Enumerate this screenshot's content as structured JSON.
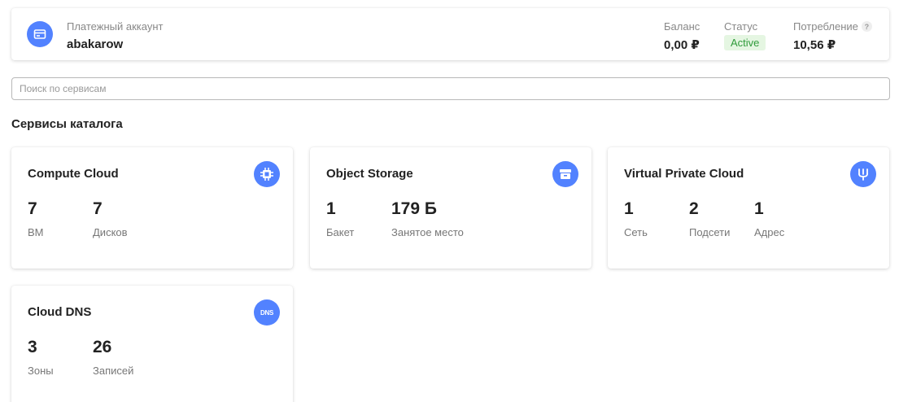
{
  "billing": {
    "label": "Платежный аккаунт",
    "name": "abakarow",
    "balance": {
      "label": "Баланс",
      "value": "0,00 ₽"
    },
    "status": {
      "label": "Статус",
      "value": "Active"
    },
    "consumption": {
      "label": "Потребление",
      "value": "10,56 ₽",
      "help": "?"
    }
  },
  "search": {
    "placeholder": "Поиск по сервисам",
    "value": ""
  },
  "section_title": "Сервисы каталога",
  "services": [
    {
      "title": "Compute Cloud",
      "icon": "chip-icon",
      "metrics": [
        {
          "value": "7",
          "label": "ВМ"
        },
        {
          "value": "7",
          "label": "Дисков"
        }
      ]
    },
    {
      "title": "Object Storage",
      "icon": "storage-box-icon",
      "metrics": [
        {
          "value": "1",
          "label": "Бакет"
        },
        {
          "value": "179 Б",
          "label": "Занятое место"
        }
      ]
    },
    {
      "title": "Virtual Private Cloud",
      "icon": "network-icon",
      "metrics": [
        {
          "value": "1",
          "label": "Сеть"
        },
        {
          "value": "2",
          "label": "Подсети"
        },
        {
          "value": "1",
          "label": "Адрес"
        }
      ]
    },
    {
      "title": "Cloud DNS",
      "icon": "dns-icon",
      "icon_text": "DNS",
      "metrics": [
        {
          "value": "3",
          "label": "Зоны"
        },
        {
          "value": "26",
          "label": "Записей"
        }
      ]
    }
  ],
  "colors": {
    "accent": "#5282ff",
    "status_bg": "#e5f6e2",
    "status_text": "#2f9b3a"
  }
}
